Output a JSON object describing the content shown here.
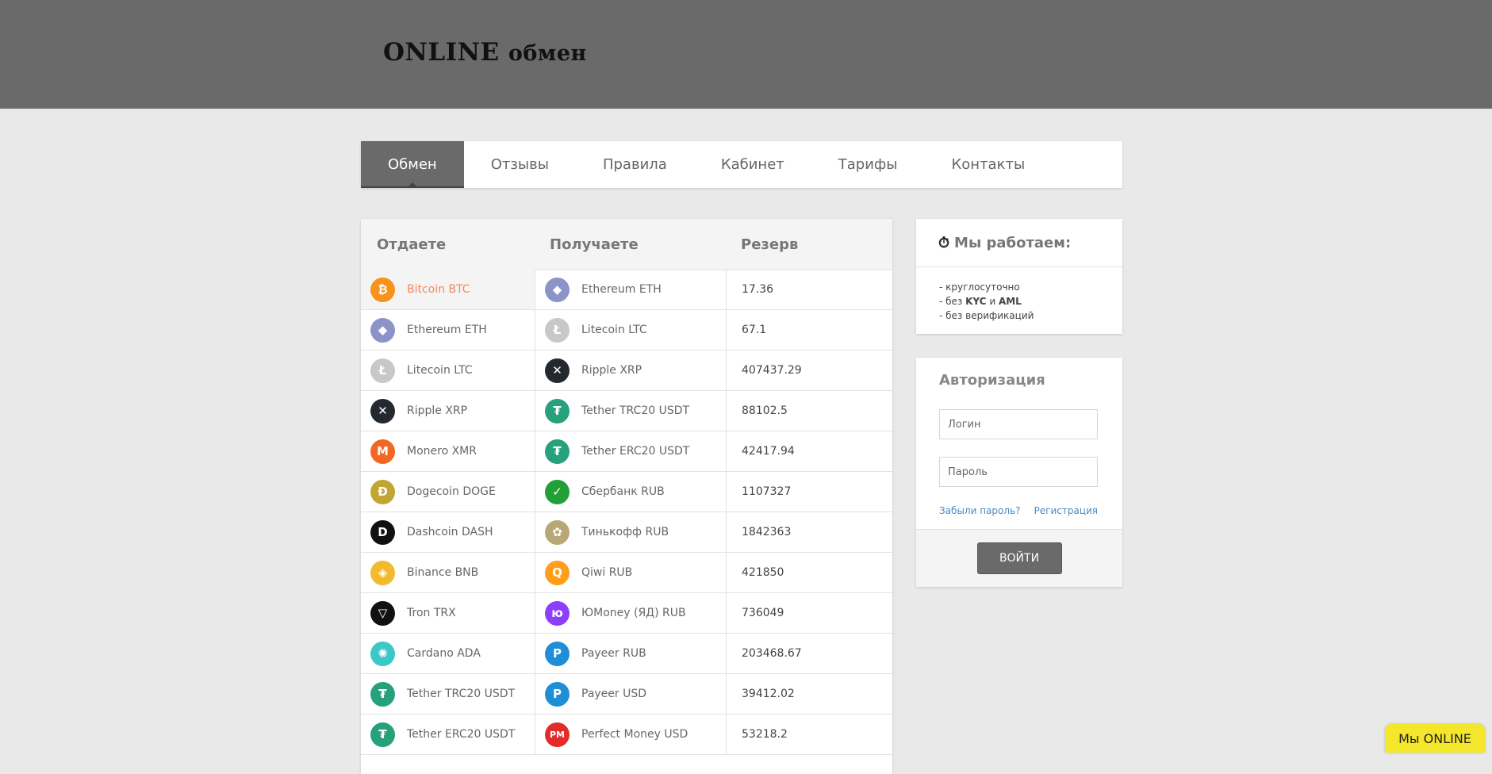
{
  "header": {
    "logo_main": "ONLINE",
    "logo_small": "обмен"
  },
  "nav": [
    {
      "label": "Обмен",
      "active": true
    },
    {
      "label": "Отзывы"
    },
    {
      "label": "Правила"
    },
    {
      "label": "Кабинет"
    },
    {
      "label": "Тарифы"
    },
    {
      "label": "Контакты"
    }
  ],
  "exchange": {
    "headers": {
      "give": "Отдаете",
      "get": "Получаете",
      "reserve": "Резерв"
    },
    "give": [
      {
        "label": "Bitcoin BTC",
        "icon": "bitcoin-icon",
        "color": "#f7931a",
        "glyph": "₿"
      },
      {
        "label": "Ethereum ETH",
        "icon": "ethereum-icon",
        "color": "#8c93c8",
        "glyph": "◆"
      },
      {
        "label": "Litecoin LTC",
        "icon": "litecoin-icon",
        "color": "#c8c8c8",
        "glyph": "Ł"
      },
      {
        "label": "Ripple XRP",
        "icon": "ripple-icon",
        "color": "#23292f",
        "glyph": "✕"
      },
      {
        "label": "Monero XMR",
        "icon": "monero-icon",
        "color": "#f26822",
        "glyph": "M"
      },
      {
        "label": "Dogecoin DOGE",
        "icon": "dogecoin-icon",
        "color": "#c2a633",
        "glyph": "Ð"
      },
      {
        "label": "Dashcoin DASH",
        "icon": "dash-icon",
        "color": "#111111",
        "glyph": "D"
      },
      {
        "label": "Binance BNB",
        "icon": "binance-icon",
        "color": "#f3ba2f",
        "glyph": "◈"
      },
      {
        "label": "Tron TRX",
        "icon": "tron-icon",
        "color": "#111111",
        "glyph": "▽"
      },
      {
        "label": "Cardano ADA",
        "icon": "cardano-icon",
        "color": "#3cc8c8",
        "glyph": "✺"
      },
      {
        "label": "Tether TRC20 USDT",
        "icon": "tether-icon",
        "color": "#26a17b",
        "glyph": "₮"
      },
      {
        "label": "Tether ERC20 USDT",
        "icon": "tether-icon",
        "color": "#26a17b",
        "glyph": "₮"
      }
    ],
    "get": [
      {
        "label": "Ethereum ETH",
        "icon": "ethereum-icon",
        "color": "#8c93c8",
        "glyph": "◆"
      },
      {
        "label": "Litecoin LTC",
        "icon": "litecoin-icon",
        "color": "#c8c8c8",
        "glyph": "Ł"
      },
      {
        "label": "Ripple XRP",
        "icon": "ripple-icon",
        "color": "#23292f",
        "glyph": "✕"
      },
      {
        "label": "Tether TRC20 USDT",
        "icon": "tether-icon",
        "color": "#26a17b",
        "glyph": "₮"
      },
      {
        "label": "Tether ERC20 USDT",
        "icon": "tether-icon",
        "color": "#26a17b",
        "glyph": "₮"
      },
      {
        "label": "Сбербанк RUB",
        "icon": "sberbank-icon",
        "color": "#21a038",
        "glyph": "✓"
      },
      {
        "label": "Тинькофф RUB",
        "icon": "tinkoff-icon",
        "color": "#b8a878",
        "glyph": "✿"
      },
      {
        "label": "Qiwi RUB",
        "icon": "qiwi-icon",
        "color": "#ff9e1b",
        "glyph": "Q"
      },
      {
        "label": "ЮMoney (ЯД) RUB",
        "icon": "yoomoney-icon",
        "color": "#8b3ffd",
        "glyph": "ю"
      },
      {
        "label": "Payeer RUB",
        "icon": "payeer-icon",
        "color": "#1e8fd6",
        "glyph": "P"
      },
      {
        "label": "Payeer USD",
        "icon": "payeer-icon",
        "color": "#1e8fd6",
        "glyph": "P"
      },
      {
        "label": "Perfect Money USD",
        "icon": "perfect-money-icon",
        "color": "#e32b2b",
        "glyph": "PM"
      }
    ],
    "reserve": [
      "17.36",
      "67.1",
      "407437.29",
      "88102.5",
      "42417.94",
      "1107327",
      "1842363",
      "421850",
      "736049",
      "203468.67",
      "39412.02",
      "53218.2"
    ]
  },
  "work": {
    "title": "Мы работаем:",
    "items": [
      {
        "pre": "- круглосуточно"
      },
      {
        "pre": "- без ",
        "b1": "KYC",
        "mid": " и ",
        "b2": "AML"
      },
      {
        "pre": "- без верификаций"
      }
    ]
  },
  "auth": {
    "title": "Авторизация",
    "login_placeholder": "Логин",
    "password_placeholder": "Пароль",
    "forgot": "Забыли пароль?",
    "register": "Регистрация",
    "submit": "ВОЙТИ"
  },
  "online_badge": "Мы ONLINE"
}
